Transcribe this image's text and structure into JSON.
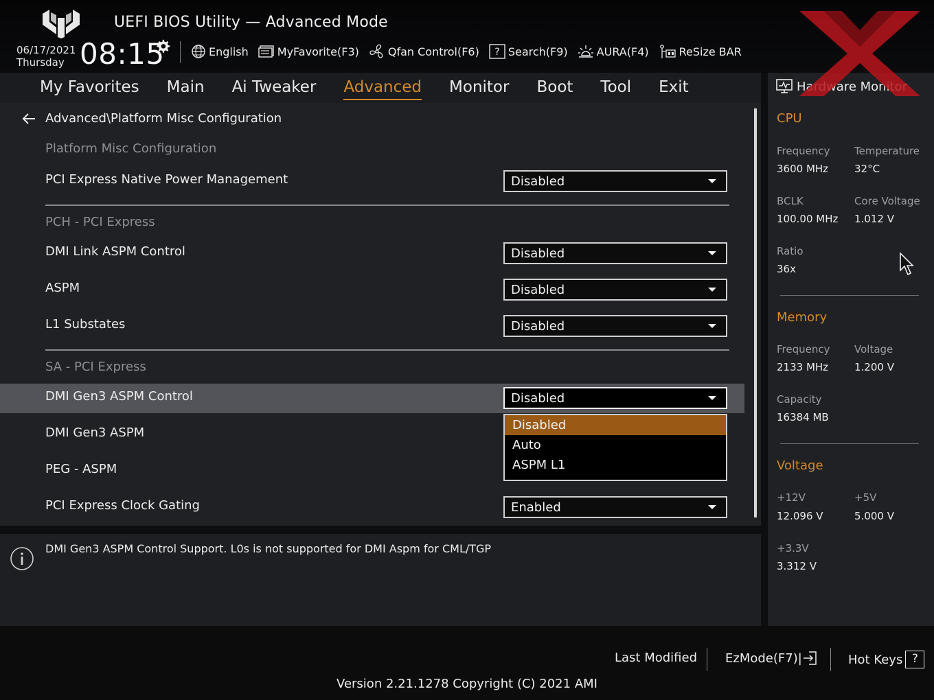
{
  "header": {
    "title": "UEFI BIOS Utility — Advanced Mode",
    "date": "06/17/2021",
    "day": "Thursday",
    "time": "08:15",
    "toolbar": [
      {
        "icon": "globe-icon",
        "label": "English"
      },
      {
        "icon": "favorite-icon",
        "label": "MyFavorite(F3)"
      },
      {
        "icon": "fan-icon",
        "label": "Qfan Control(F6)"
      },
      {
        "icon": "search-help-icon",
        "label": "Search(F9)"
      },
      {
        "icon": "aura-icon",
        "label": "AURA(F4)"
      },
      {
        "icon": "resize-bar-icon",
        "label": "ReSize BAR"
      }
    ]
  },
  "tabs": [
    {
      "label": "My Favorites",
      "active": false
    },
    {
      "label": "Main",
      "active": false
    },
    {
      "label": "Ai Tweaker",
      "active": false
    },
    {
      "label": "Advanced",
      "active": true
    },
    {
      "label": "Monitor",
      "active": false
    },
    {
      "label": "Boot",
      "active": false
    },
    {
      "label": "Tool",
      "active": false
    },
    {
      "label": "Exit",
      "active": false
    }
  ],
  "main": {
    "breadcrumb": "Advanced\\Platform Misc Configuration",
    "sections": {
      "platform": "Platform Misc Configuration",
      "pch": "PCH - PCI Express",
      "sa": "SA - PCI Express"
    },
    "settings": {
      "pcie_native_pm": {
        "label": "PCI Express Native Power Management",
        "value": "Disabled"
      },
      "dmi_link_aspm": {
        "label": "DMI Link ASPM Control",
        "value": "Disabled"
      },
      "aspm": {
        "label": "ASPM",
        "value": "Disabled"
      },
      "l1_substates": {
        "label": "L1 Substates",
        "value": "Disabled"
      },
      "dmi_gen3_aspm_control": {
        "label": "DMI Gen3 ASPM Control",
        "value": "Disabled"
      },
      "dmi_gen3_aspm": {
        "label": "DMI Gen3 ASPM"
      },
      "peg_aspm": {
        "label": "PEG - ASPM"
      },
      "pcie_clock_gating": {
        "label": "PCI Express Clock Gating",
        "value": "Enabled"
      }
    },
    "dropdown_options": [
      "Disabled",
      "Auto",
      "ASPM L1"
    ],
    "dropdown_selected": "Disabled"
  },
  "info": {
    "text": "DMI Gen3 ASPM Control Support. L0s is not supported for DMI Aspm for CML/TGP"
  },
  "hardware_monitor": {
    "title": "Hardware Monitor",
    "cpu": {
      "title": "CPU",
      "frequency_label": "Frequency",
      "frequency": "3600 MHz",
      "temperature_label": "Temperature",
      "temperature": "32°C",
      "bclk_label": "BCLK",
      "bclk": "100.00 MHz",
      "core_voltage_label": "Core Voltage",
      "core_voltage": "1.012 V",
      "ratio_label": "Ratio",
      "ratio": "36x"
    },
    "memory": {
      "title": "Memory",
      "frequency_label": "Frequency",
      "frequency": "2133 MHz",
      "voltage_label": "Voltage",
      "voltage": "1.200 V",
      "capacity_label": "Capacity",
      "capacity": "16384 MB"
    },
    "voltage": {
      "title": "Voltage",
      "v12_label": "+12V",
      "v12": "12.096 V",
      "v5_label": "+5V",
      "v5": "5.000 V",
      "v33_label": "+3.3V",
      "v33": "3.312 V"
    }
  },
  "footer": {
    "last_modified": "Last Modified",
    "ezmode": "EzMode(F7)|",
    "hot_keys": "Hot Keys",
    "hot_keys_symbol": "?",
    "version": "Version 2.21.1278 Copyright (C) 2021 AMI"
  },
  "colors": {
    "accent": "#d28a2c",
    "selected_option": "#9a5a16",
    "highlight_row": "#535459",
    "watermark": "#b8141c"
  }
}
